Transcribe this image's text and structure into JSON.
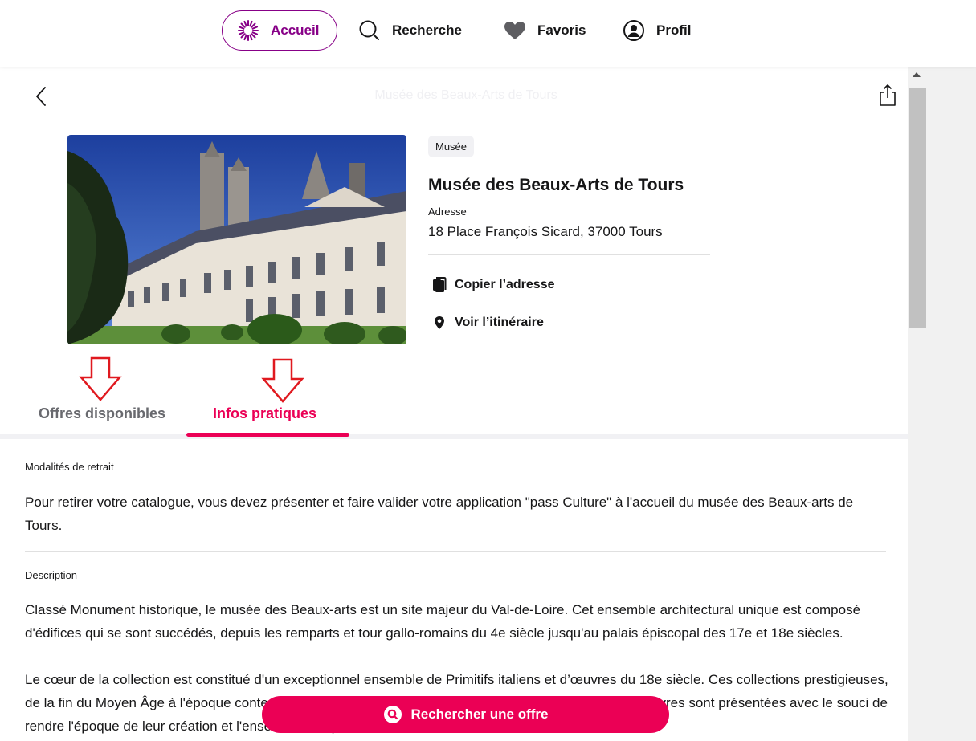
{
  "nav": {
    "items": [
      {
        "label": "Accueil",
        "icon": "sun-burst-icon",
        "active": true
      },
      {
        "label": "Recherche",
        "icon": "search-icon"
      },
      {
        "label": "Favoris",
        "icon": "heart-icon"
      },
      {
        "label": "Profil",
        "icon": "profile-icon"
      }
    ],
    "accent": "#870087"
  },
  "header": {
    "title": "Musée des Beaux-Arts de Tours"
  },
  "venue": {
    "category": "Musée",
    "name": "Musée des Beaux-Arts de Tours",
    "address_label": "Adresse",
    "address": "18 Place François Sicard, 37000 Tours",
    "actions": {
      "copy": "Copier l’adresse",
      "route": "Voir l’itinéraire"
    }
  },
  "tabs": [
    {
      "label": "Offres disponibles",
      "active": false
    },
    {
      "label": "Infos pratiques",
      "active": true
    }
  ],
  "sections": {
    "withdrawal": {
      "label": "Modalités de retrait",
      "text": "Pour retirer votre catalogue, vous devez présenter et faire valider votre application \"pass Culture\" à l'accueil du musée des Beaux-arts de Tours."
    },
    "description": {
      "label": "Description",
      "p1": "Classé Monument historique, le musée des Beaux-arts est un site majeur du Val-de-Loire. Cet ensemble architectural unique est composé d'édifices qui se sont succédés, depuis les remparts et tour gallo-romains du 4e siècle jusqu'au palais épiscopal des 17e et 18e siècles.",
      "p2": "Le cœur de la collection est constitué d'un exceptionnel ensemble de Primitifs italiens et d’œuvres du 18e siècle. Ces collections prestigieuses, de la fin du Moyen Âge à l'époque contemporaine, en font un des plus riches musées de France. Les œuvres sont présentées avec le souci de rendre l'époque de leur création et l'ensemble évoque l'univers"
    }
  },
  "search_button": {
    "label": "Rechercher une offre"
  },
  "colors": {
    "primary": "#eb0055",
    "accent": "#870087"
  }
}
